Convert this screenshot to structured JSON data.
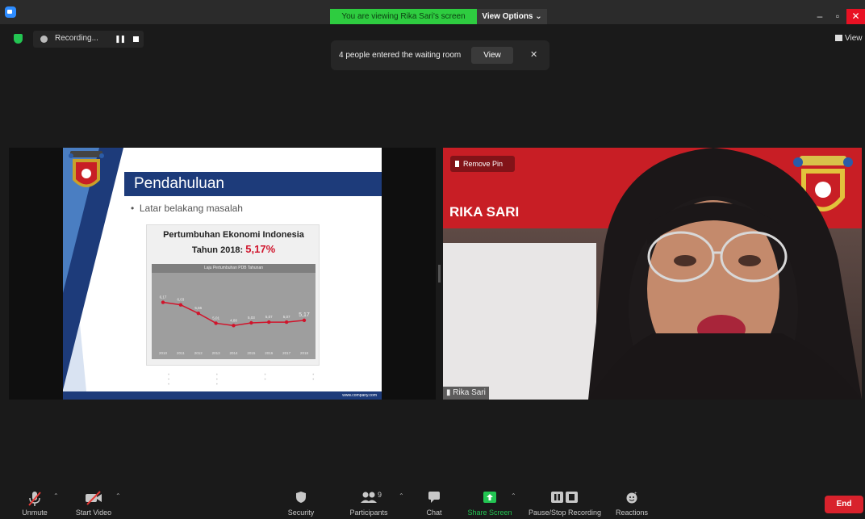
{
  "titlebar": {
    "banner": "You are viewing Rika Sari's screen",
    "view_options": "View Options ⌄",
    "minimize": "–",
    "maximize": "▫",
    "close": "✕"
  },
  "topbar": {
    "recording_text": "Recording...",
    "pause_glyph": "❚❚",
    "view_label": "View"
  },
  "notification": {
    "text": "4 people entered the waiting room",
    "view_button": "View",
    "close": "✕"
  },
  "slide": {
    "title": "Pendahuluan",
    "bullet": "Latar belakang masalah",
    "chart_title_line1": "Pertumbuhan Ekonomi Indonesia",
    "chart_title_line2": "Tahun 2018: ",
    "chart_title_highlight": "5,17%",
    "chart_inner_title": "Laju Pertumbuhan PDB Tahunan",
    "footer": "www.company.com"
  },
  "chart_data": {
    "type": "line",
    "title": "Laju Pertumbuhan PDB Tahunan",
    "categories": [
      "2010",
      "2011",
      "2012",
      "2013",
      "2014",
      "2015",
      "2016",
      "2017",
      "2018"
    ],
    "values": [
      6.17,
      6.03,
      5.56,
      5.01,
      4.88,
      5.03,
      5.07,
      5.07,
      5.17
    ],
    "data_labels": [
      "6,17",
      "6,03",
      "5,56",
      "5,01",
      "4,88",
      "5,03",
      "5,07",
      "5,07",
      "5,17"
    ],
    "line_color": "#d0142b",
    "ylim": [
      4,
      7
    ],
    "grid": false
  },
  "video": {
    "remove_pin": "Remove Pin",
    "name_banner": "RIKA SARI",
    "participant_label": "Rika Sari"
  },
  "toolbar": {
    "unmute": "Unmute",
    "start_video": "Start Video",
    "security": "Security",
    "participants": "Participants",
    "participants_count": "9",
    "chat": "Chat",
    "share_screen": "Share Screen",
    "pause_stop_recording": "Pause/Stop Recording",
    "reactions": "Reactions",
    "end": "End"
  },
  "colors": {
    "share_banner": "#2ecc40",
    "end_button": "#d8222c",
    "slide_accent": "#1d3b7a",
    "highlight": "#d0142b"
  }
}
